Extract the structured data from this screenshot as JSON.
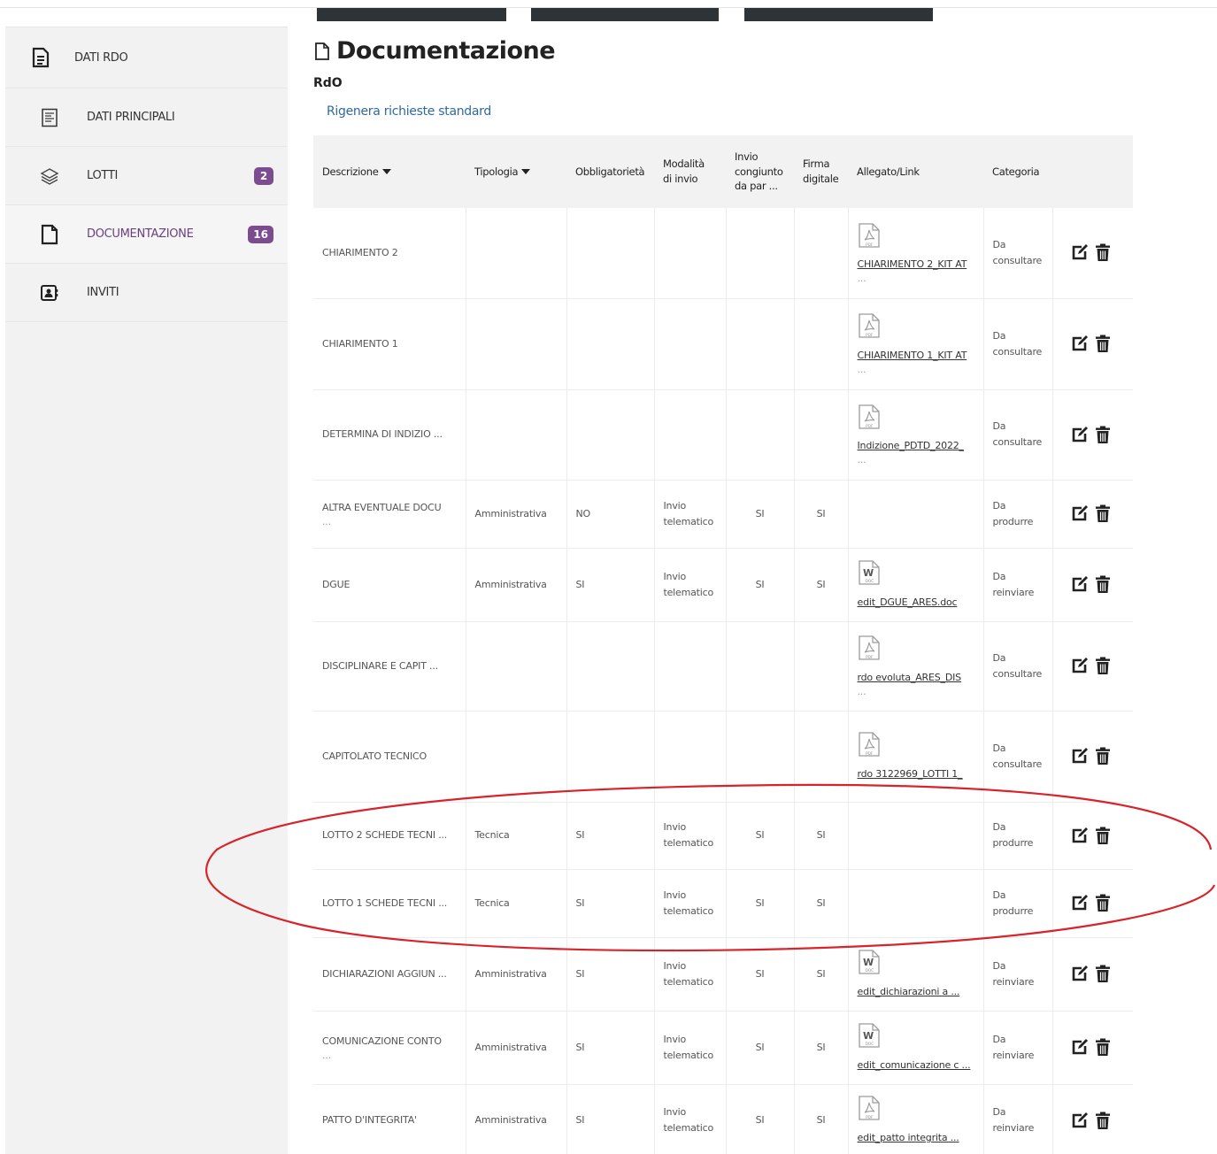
{
  "sidebar": {
    "items": [
      {
        "label": "DATI RDO",
        "icon": "document-list-icon",
        "badge": ""
      },
      {
        "label": "DATI PRINCIPALI",
        "icon": "form-icon",
        "badge": ""
      },
      {
        "label": "LOTTI",
        "icon": "layers-icon",
        "badge": "2"
      },
      {
        "label": "DOCUMENTAZIONE",
        "icon": "file-icon",
        "badge": "16"
      },
      {
        "label": "INVITI",
        "icon": "contacts-icon",
        "badge": ""
      }
    ]
  },
  "main": {
    "title": "Documentazione",
    "subtitle": "RdO",
    "regen_link": "Rigenera richieste standard"
  },
  "table": {
    "headers": {
      "descrizione": "Descrizione",
      "tipologia": "Tipologia",
      "obbligatorieta": "Obbligatorietà",
      "modalita1": "Modalità",
      "modalita2": "di invio",
      "invio1": "Invio",
      "invio2": "congiunto",
      "invio3": "da par ...",
      "firma1": "Firma",
      "firma2": "digitale",
      "allegato": "Allegato/Link",
      "categoria": "Categoria"
    },
    "rows": [
      {
        "desc": "CHIARIMENTO 2",
        "desc_more": "",
        "tipologia": "",
        "obblig": "",
        "mod1": "",
        "mod2": "",
        "invio": "",
        "firma": "",
        "file_type": "pdf",
        "file": "CHIARIMENTO 2_KIT AT",
        "file_more": "...",
        "cat1": "Da",
        "cat2": "consultare"
      },
      {
        "desc": "CHIARIMENTO 1",
        "desc_more": "",
        "tipologia": "",
        "obblig": "",
        "mod1": "",
        "mod2": "",
        "invio": "",
        "firma": "",
        "file_type": "pdf",
        "file": "CHIARIMENTO 1_KIT AT",
        "file_more": "...",
        "cat1": "Da",
        "cat2": "consultare"
      },
      {
        "desc": "DETERMINA DI INDIZIO ...",
        "desc_more": "",
        "tipologia": "",
        "obblig": "",
        "mod1": "",
        "mod2": "",
        "invio": "",
        "firma": "",
        "file_type": "pdf",
        "file": "Indizione_PDTD_2022_",
        "file_more": "...",
        "cat1": "Da",
        "cat2": "consultare"
      },
      {
        "desc": "ALTRA EVENTUALE DOCU",
        "desc_more": "...",
        "tipologia": "Amministrativa",
        "obblig": "NO",
        "mod1": "Invio",
        "mod2": "telematico",
        "invio": "SI",
        "firma": "SI",
        "file_type": "",
        "file": "",
        "file_more": "",
        "cat1": "Da",
        "cat2": "produrre"
      },
      {
        "desc": "DGUE",
        "desc_more": "",
        "tipologia": "Amministrativa",
        "obblig": "SI",
        "mod1": "Invio",
        "mod2": "telematico",
        "invio": "SI",
        "firma": "SI",
        "file_type": "doc",
        "file": "edit_DGUE_ARES.doc",
        "file_more": "",
        "cat1": "Da",
        "cat2": "reinviare"
      },
      {
        "desc": "DISCIPLINARE E CAPIT ...",
        "desc_more": "",
        "tipologia": "",
        "obblig": "",
        "mod1": "",
        "mod2": "",
        "invio": "",
        "firma": "",
        "file_type": "pdf",
        "file": "rdo evoluta_ARES_DIS",
        "file_more": "...",
        "cat1": "Da",
        "cat2": "consultare"
      },
      {
        "desc": "CAPITOLATO TECNICO",
        "desc_more": "",
        "tipologia": "",
        "obblig": "",
        "mod1": "",
        "mod2": "",
        "invio": "",
        "firma": "",
        "file_type": "pdf",
        "file": "rdo 3122969_LOTTI 1_",
        "file_more": "",
        "cat1": "Da",
        "cat2": "consultare"
      },
      {
        "desc": "LOTTO 2 SCHEDE TECNI ...",
        "desc_more": "",
        "tipologia": "Tecnica",
        "obblig": "SI",
        "mod1": "Invio",
        "mod2": "telematico",
        "invio": "SI",
        "firma": "SI",
        "file_type": "",
        "file": "",
        "file_more": "",
        "cat1": "Da",
        "cat2": "produrre"
      },
      {
        "desc": "LOTTO 1 SCHEDE TECNI ...",
        "desc_more": "",
        "tipologia": "Tecnica",
        "obblig": "SI",
        "mod1": "Invio",
        "mod2": "telematico",
        "invio": "SI",
        "firma": "SI",
        "file_type": "",
        "file": "",
        "file_more": "",
        "cat1": "Da",
        "cat2": "produrre"
      },
      {
        "desc": "DICHIARAZIONI AGGIUN ...",
        "desc_more": "",
        "tipologia": "Amministrativa",
        "obblig": "SI",
        "mod1": "Invio",
        "mod2": "telematico",
        "invio": "SI",
        "firma": "SI",
        "file_type": "doc",
        "file": "edit_dichiarazioni a ...",
        "file_more": "",
        "cat1": "Da",
        "cat2": "reinviare"
      },
      {
        "desc": "COMUNICAZIONE CONTO",
        "desc_more": "...",
        "tipologia": "Amministrativa",
        "obblig": "SI",
        "mod1": "Invio",
        "mod2": "telematico",
        "invio": "SI",
        "firma": "SI",
        "file_type": "doc",
        "file": "edit_comunicazione c ...",
        "file_more": "",
        "cat1": "Da",
        "cat2": "reinviare"
      },
      {
        "desc": "PATTO D'INTEGRITA'",
        "desc_more": "",
        "tipologia": "Amministrativa",
        "obblig": "SI",
        "mod1": "Invio",
        "mod2": "telematico",
        "invio": "SI",
        "firma": "SI",
        "file_type": "pdf",
        "file": "edit_patto integrita ...",
        "file_more": "",
        "cat1": "Da",
        "cat2": "reinviare"
      }
    ]
  },
  "colors": {
    "accent": "#7d4b8f",
    "active_text": "#6a3f7e",
    "link": "#2f6a9c",
    "annotation": "#d8232a"
  }
}
